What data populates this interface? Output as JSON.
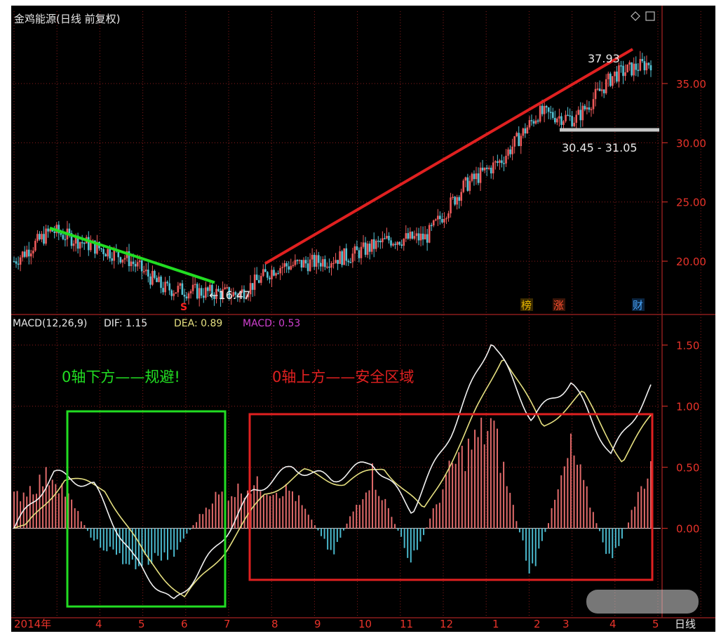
{
  "header": {
    "title": "金鸡能源(日线 前复权)"
  },
  "chart_data": [
    {
      "type": "candlestick",
      "title": "金鸡能源(日线 前复权)",
      "y_ticks": [
        "35.00",
        "30.00",
        "25.00",
        "20.00"
      ],
      "ylim": [
        15.5,
        39.8
      ],
      "annotations": {
        "high_label": "37.93",
        "low_label": "←16.47",
        "range_label": "30.45 - 31.05"
      },
      "markers": [
        {
          "label": "S",
          "color": "#ff2020"
        },
        {
          "label": "榜",
          "color": "#e8b800"
        },
        {
          "label": "涨",
          "color": "#ff5030"
        },
        {
          "label": "财",
          "color": "#4aa8ff"
        }
      ],
      "trend_lines": [
        {
          "color": "#22dd22",
          "from": {
            "x": "2014-03",
            "y": 22.8
          },
          "to": {
            "x": "2014-07",
            "y": 18.2
          }
        },
        {
          "color": "#e02020",
          "from": {
            "x": "2014-07",
            "y": 19.8
          },
          "to": {
            "x": "2015-04",
            "y": 37.9
          }
        }
      ],
      "price_path": [
        [
          "2014-01",
          20.0
        ],
        [
          "2014-02",
          22.6
        ],
        [
          "2014-03",
          21.4
        ],
        [
          "2014-04",
          20.3
        ],
        [
          "2014-05",
          17.7
        ],
        [
          "2014-06",
          17.4
        ],
        [
          "2014-07",
          17.2
        ],
        [
          "2014-07b",
          19.5
        ],
        [
          "2014-08",
          19.9
        ],
        [
          "2014-09",
          20.5
        ],
        [
          "2014-10",
          21.8
        ],
        [
          "2014-11",
          22.0
        ],
        [
          "2014-12",
          26.3
        ],
        [
          "2015-01",
          28.5
        ],
        [
          "2015-02",
          32.5
        ],
        [
          "2015-03",
          32.0
        ],
        [
          "2015-04",
          35.7
        ],
        [
          "2015-05",
          36.8
        ]
      ]
    },
    {
      "type": "macd",
      "indicator_label": "MACD(12,26,9)",
      "dif_label": "DIF: 1.15",
      "dea_label": "DEA: 0.89",
      "macd_label": "MACD: 0.53",
      "y_ticks": [
        "1.50",
        "1.00",
        "0.50",
        "0.00"
      ],
      "ylim": [
        -0.72,
        1.75
      ],
      "x_ticks": [
        "2014年",
        "4",
        "5",
        "6",
        "7",
        "8",
        "9",
        "10",
        "11",
        "12",
        "1",
        "2",
        "3",
        "4",
        "5"
      ],
      "period_label": "日线",
      "annotations": [
        {
          "text": "0轴下方——规避!",
          "color": "#22dd22"
        },
        {
          "text": "0轴上方——安全区域",
          "color": "#e02020"
        }
      ],
      "dif_path": [
        [
          "2014-01",
          0.0
        ],
        [
          "2014-02",
          0.45
        ],
        [
          "2014-03",
          0.35
        ],
        [
          "2014-04",
          -0.25
        ],
        [
          "2014-05",
          -0.62
        ],
        [
          "2014-06",
          -0.2
        ],
        [
          "2014-07",
          0.3
        ],
        [
          "2014-08",
          0.5
        ],
        [
          "2014-09",
          0.4
        ],
        [
          "2014-10",
          0.55
        ],
        [
          "2014-11",
          0.15
        ],
        [
          "2014-12",
          0.8
        ],
        [
          "2015-01",
          1.55
        ],
        [
          "2015-02",
          0.9
        ],
        [
          "2015-03",
          1.2
        ],
        [
          "2015-04",
          0.6
        ],
        [
          "2015-05",
          1.15
        ]
      ],
      "histogram_path": [
        [
          "2014-01",
          0.25
        ],
        [
          "2014-02",
          0.45
        ],
        [
          "2014-03",
          -0.1
        ],
        [
          "2014-04",
          -0.3
        ],
        [
          "2014-05",
          -0.2
        ],
        [
          "2014-06",
          0.25
        ],
        [
          "2014-07",
          0.35
        ],
        [
          "2014-08",
          0.3
        ],
        [
          "2014-09",
          -0.2
        ],
        [
          "2014-10",
          0.45
        ],
        [
          "2014-11",
          -0.28
        ],
        [
          "2014-12",
          0.5
        ],
        [
          "2015-01",
          0.85
        ],
        [
          "2015-02",
          -0.4
        ],
        [
          "2015-03",
          0.65
        ],
        [
          "2015-04",
          -0.3
        ],
        [
          "2015-05",
          0.53
        ]
      ]
    }
  ],
  "colors": {
    "background": "#000000",
    "grid": "#8a1c1c",
    "axis_text": "#e8332a",
    "candle_up": "#ee5a5a",
    "candle_down": "#54c4d6",
    "dif": "#f2f2f2",
    "dea": "#e6e080",
    "macd_bar_up": "#e06a6a",
    "macd_bar_down": "#4ab8cc"
  }
}
